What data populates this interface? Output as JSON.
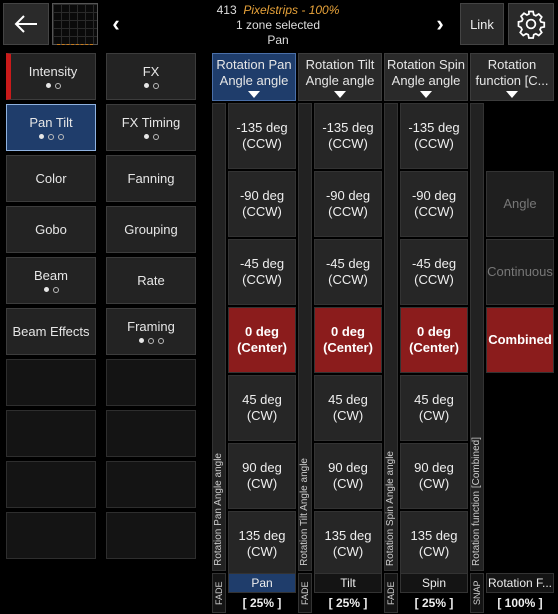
{
  "header": {
    "fixture_count": "413",
    "fixture_name": "Pixelstrips",
    "separator": "-",
    "intensity": "100%",
    "zones": "1 zone selected",
    "current_attribute": "Pan",
    "link_label": "Link"
  },
  "features": [
    {
      "label": "Intensity",
      "dots": "on,off"
    },
    {
      "label": "FX",
      "dots": "on,off"
    },
    {
      "label": "Pan Tilt",
      "dots": "on,off,off"
    },
    {
      "label": "FX Timing",
      "dots": "on,off"
    },
    {
      "label": "Color",
      "dots": ""
    },
    {
      "label": "Fanning",
      "dots": ""
    },
    {
      "label": "Gobo",
      "dots": ""
    },
    {
      "label": "Grouping",
      "dots": ""
    },
    {
      "label": "Beam",
      "dots": "on,off"
    },
    {
      "label": "Rate",
      "dots": ""
    },
    {
      "label": "Beam Effects",
      "dots": ""
    },
    {
      "label": "Framing",
      "dots": "on,off,off"
    }
  ],
  "columns": [
    {
      "title": "Rotation Pan Angle angle",
      "vertical_label": "Rotation Pan Angle angle",
      "mode": "FADE",
      "name": "Pan",
      "percent": "[ 25% ]",
      "values": [
        "-135 deg (CCW)",
        "-90 deg (CCW)",
        "-45 deg (CCW)",
        "0 deg (Center)",
        "45 deg (CW)",
        "90 deg (CW)",
        "135 deg (CW)"
      ]
    },
    {
      "title": "Rotation Tilt Angle angle",
      "vertical_label": "Rotation Tilt Angle angle",
      "mode": "FADE",
      "name": "Tilt",
      "percent": "[ 25% ]",
      "values": [
        "-135 deg (CCW)",
        "-90 deg (CCW)",
        "-45 deg (CCW)",
        "0 deg (Center)",
        "45 deg (CW)",
        "90 deg (CW)",
        "135 deg (CW)"
      ]
    },
    {
      "title": "Rotation Spin Angle angle",
      "vertical_label": "Rotation Spin Angle angle",
      "mode": "FADE",
      "name": "Spin",
      "percent": "[ 25% ]",
      "values": [
        "-135 deg (CCW)",
        "-90 deg (CCW)",
        "-45 deg (CCW)",
        "0 deg (Center)",
        "45 deg (CW)",
        "90 deg (CW)",
        "135 deg (CW)"
      ]
    },
    {
      "title": "Rotation function [C...",
      "vertical_label": "Rotation function [Combined]",
      "mode": "SNAP",
      "name": "Rotation F...",
      "percent": "[ 100% ]",
      "values": [
        "Angle",
        "Continuous",
        "Combined"
      ]
    }
  ],
  "colors": {
    "accent_blue": "#1f3d6b",
    "selected_red": "#8b1c1c",
    "intensity_red": "#c81a1a",
    "orange": "#e8a33a"
  }
}
